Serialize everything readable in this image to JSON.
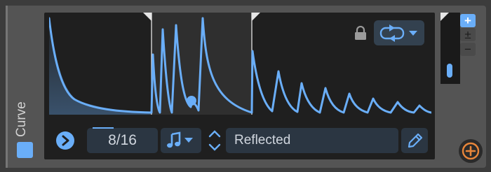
{
  "device": {
    "label": "Curve",
    "color": "#6aaef8"
  },
  "controls": {
    "steps": "8/16",
    "mode": "Reflected"
  },
  "zoom": {
    "plus": "+",
    "plus_minus": "±",
    "minus": "−"
  },
  "colors": {
    "accent": "#6aaef8",
    "field_bg": "#2b3642",
    "panel_bg": "#1f1f1f"
  },
  "icons": {
    "play": "play-icon",
    "note": "note-icon",
    "loop": "loop-icon",
    "lock": "lock-icon",
    "edit": "pencil-icon",
    "add": "plus-circle-icon"
  }
}
